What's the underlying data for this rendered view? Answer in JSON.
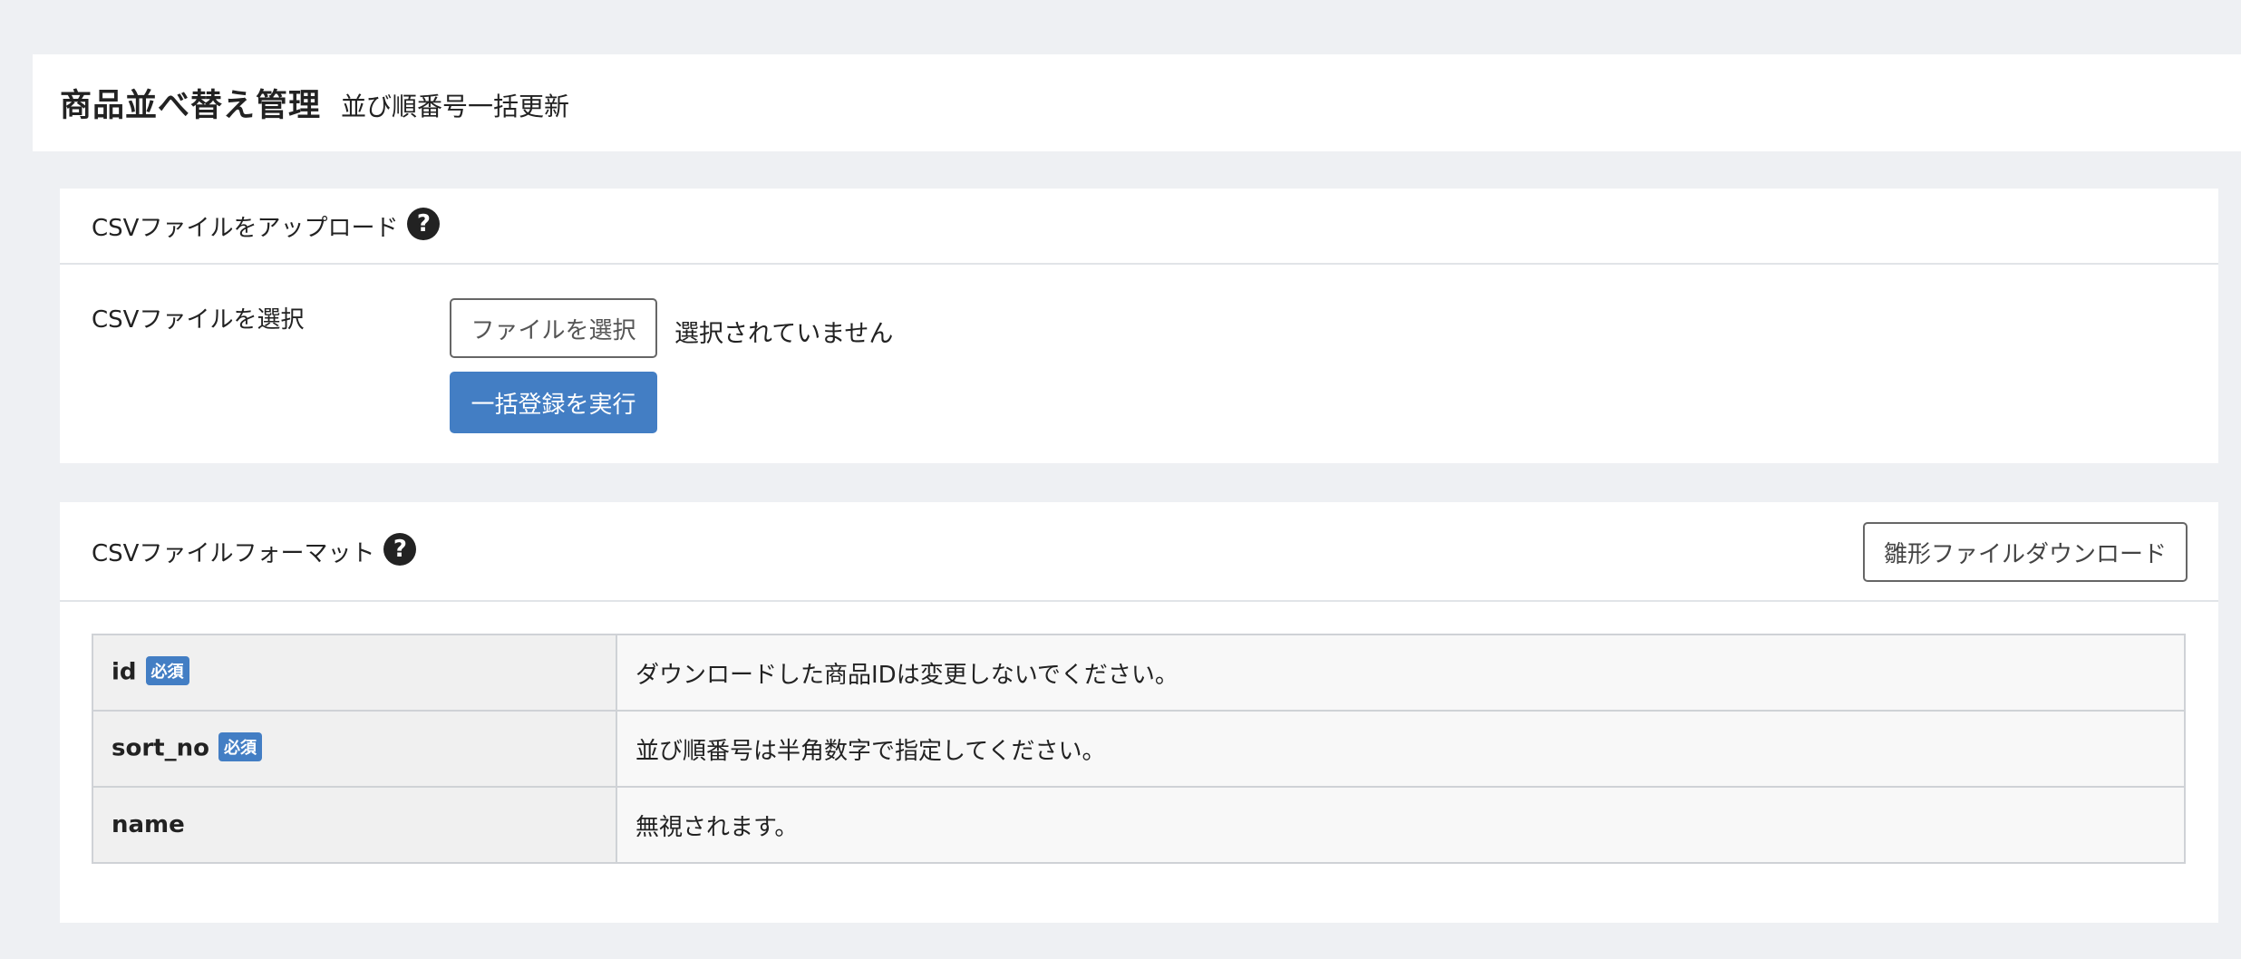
{
  "header": {
    "title": "商品並べ替え管理",
    "subtitle": "並び順番号一括更新"
  },
  "upload_card": {
    "title": "CSVファイルをアップロード",
    "help_icon": "question-circle-icon",
    "field_label": "CSVファイルを選択",
    "file_button_label": "ファイルを選択",
    "file_status": "選択されていません",
    "submit_label": "一括登録を実行"
  },
  "format_card": {
    "title": "CSVファイルフォーマット",
    "help_icon": "question-circle-icon",
    "download_label": "雛形ファイルダウンロード",
    "rows": [
      {
        "key": "id",
        "required": "必須",
        "desc": "ダウンロードした商品IDは変更しないでください。"
      },
      {
        "key": "sort_no",
        "required": "必須",
        "desc": "並び順番号は半角数字で指定してください。"
      },
      {
        "key": "name",
        "required": "",
        "desc": "無視されます。"
      }
    ]
  },
  "colors": {
    "background": "#eef0f3",
    "primary": "#437ec4",
    "card": "#ffffff"
  }
}
